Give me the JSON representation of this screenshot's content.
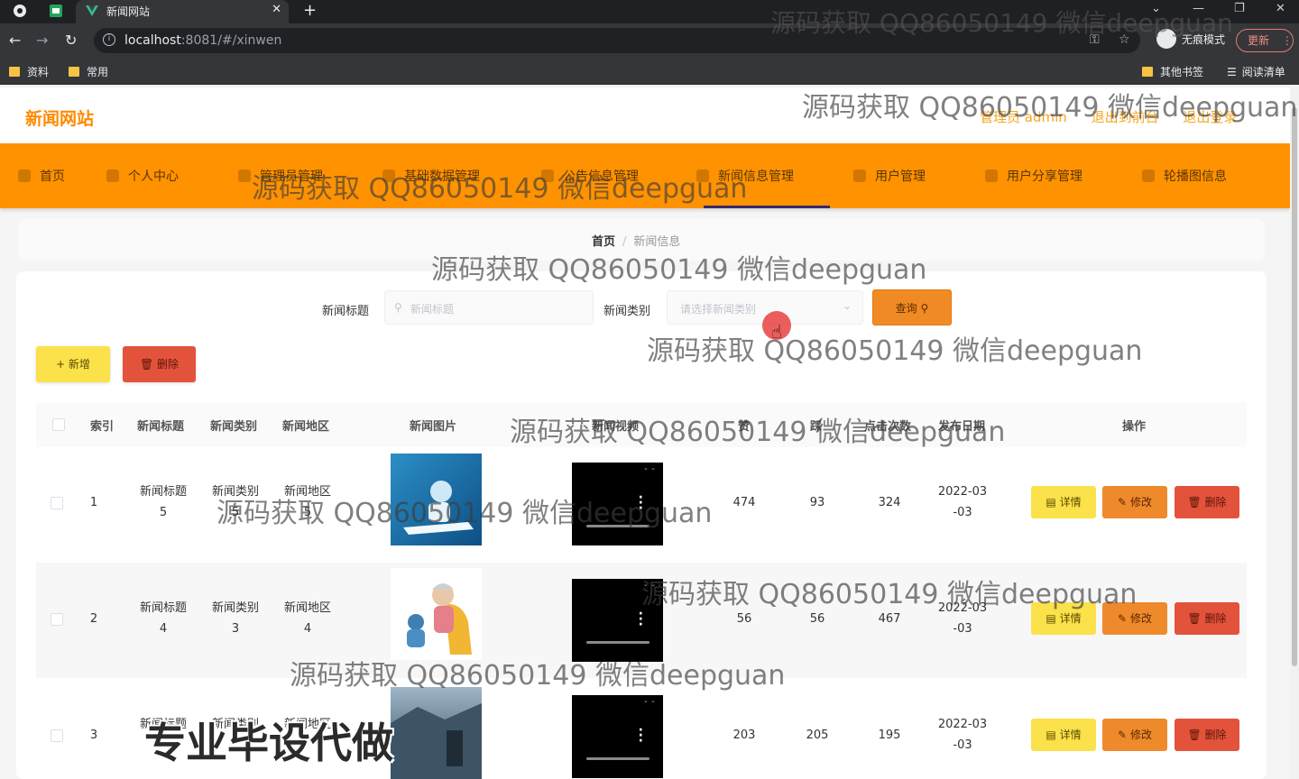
{
  "browser": {
    "tab_title": "新闻网站",
    "url_host": "localhost",
    "url_rest": ":8081/#/xinwen",
    "profile_label": "无痕模式",
    "update_label": "更新",
    "bookmarks": [
      "资料",
      "常用"
    ],
    "bookmarks_right": [
      "其他书签",
      "阅读清单"
    ]
  },
  "header": {
    "brand": "新闻网站",
    "admin_label": "管理员 admin",
    "back_label": "退出到前台",
    "logout_label": "退出登录"
  },
  "nav": {
    "items": [
      "首页",
      "个人中心",
      "管理员管理",
      "基础数据管理",
      "公告信息管理",
      "新闻信息管理",
      "用户管理",
      "用户分享管理",
      "轮播图信息"
    ]
  },
  "breadcrumb": {
    "home": "首页",
    "sep": "/",
    "current": "新闻信息"
  },
  "search": {
    "title_label": "新闻标题",
    "title_placeholder": "新闻标题",
    "type_label": "新闻类别",
    "type_placeholder": "请选择新闻类别",
    "query_label": "查询"
  },
  "actions": {
    "add_label": "+ 新增",
    "delete_label": "删除"
  },
  "table": {
    "headers": [
      "索引",
      "新闻标题",
      "新闻类别",
      "新闻地区",
      "新闻图片",
      "新闻视频",
      "赞",
      "踩",
      "点击次数",
      "发布日期",
      "操作"
    ],
    "rows": [
      {
        "index": "1",
        "title1": "新闻标题",
        "title2": "5",
        "type1": "新闻类别",
        "type2": "5",
        "region1": "新闻地区",
        "region2": "5",
        "likes": "474",
        "dislikes": "93",
        "clicks": "324",
        "date1": "2022-03",
        "date2": "-03"
      },
      {
        "index": "2",
        "title1": "新闻标题",
        "title2": "4",
        "type1": "新闻类别",
        "type2": "3",
        "region1": "新闻地区",
        "region2": "4",
        "likes": "56",
        "dislikes": "56",
        "clicks": "467",
        "date1": "2022-03",
        "date2": "-03"
      },
      {
        "index": "3",
        "title1": "新闻标题",
        "title2": "",
        "type1": "新闻类别",
        "type2": "",
        "region1": "新闻地区",
        "region2": "",
        "likes": "203",
        "dislikes": "205",
        "clicks": "195",
        "date1": "2022-03",
        "date2": "-03"
      }
    ],
    "op_detail": "详情",
    "op_edit": "修改",
    "op_delete": "删除"
  },
  "watermark": {
    "text": "源码获取 QQ86050149 微信deepguan",
    "big_text": "专业毕设代做"
  }
}
